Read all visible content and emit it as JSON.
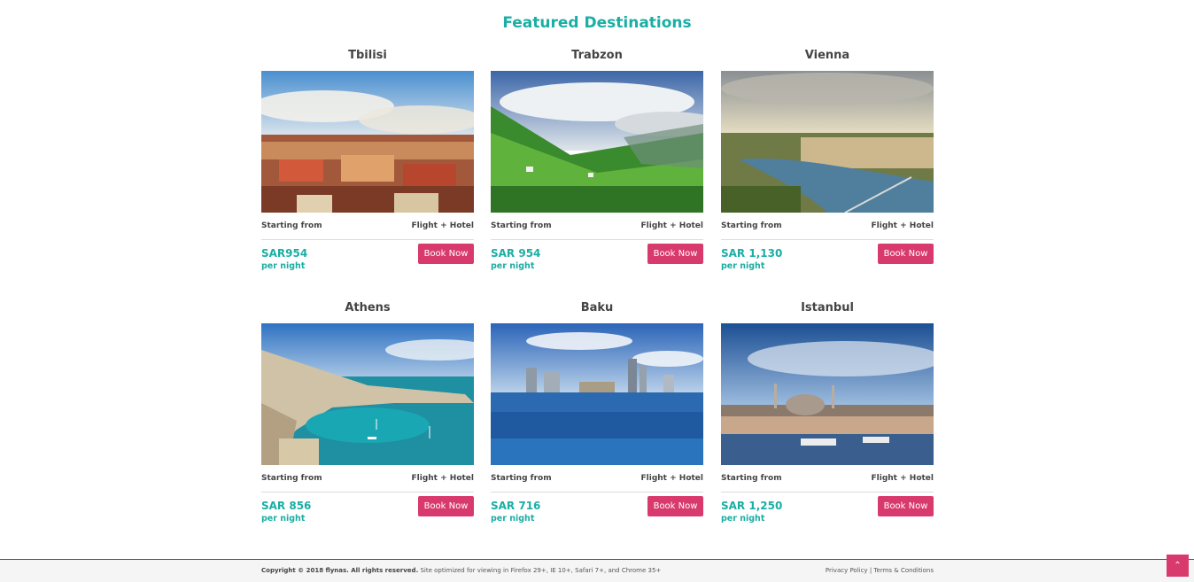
{
  "heading": "Featured Destinations",
  "colors": {
    "accent": "#1aaea4",
    "button": "#d93a6e"
  },
  "destinations": [
    {
      "city": "Tbilisi",
      "starting": "Starting from",
      "package": "Flight + Hotel",
      "price": "SAR954",
      "per": "per night",
      "button": "Book Now"
    },
    {
      "city": "Trabzon",
      "starting": "Starting from",
      "package": "Flight + Hotel",
      "price": "SAR 954",
      "per": "per night",
      "button": "Book Now"
    },
    {
      "city": "Vienna",
      "starting": "Starting from",
      "package": "Flight + Hotel",
      "price": "SAR 1,130",
      "per": "per night",
      "button": "Book Now"
    },
    {
      "city": "Athens",
      "starting": "Starting from",
      "package": "Flight + Hotel",
      "price": "SAR 856",
      "per": "per night",
      "button": "Book Now"
    },
    {
      "city": "Baku",
      "starting": "Starting from",
      "package": "Flight + Hotel",
      "price": "SAR 716",
      "per": "per night",
      "button": "Book Now"
    },
    {
      "city": "Istanbul",
      "starting": "Starting from",
      "package": "Flight + Hotel",
      "price": "SAR 1,250",
      "per": "per night",
      "button": "Book Now"
    }
  ],
  "footer": {
    "copyright": "Copyright © 2018 flynas. All rights reserved.",
    "optimized": "Site optimized for viewing in Firefox 29+, IE 10+, Safari 7+, and Chrome 35+",
    "privacy": "Privacy Policy",
    "separator": "|",
    "terms": "Terms & Conditions"
  },
  "scroll_top_icon": "chevron-up-icon",
  "scroll_top_glyph": "⌃"
}
